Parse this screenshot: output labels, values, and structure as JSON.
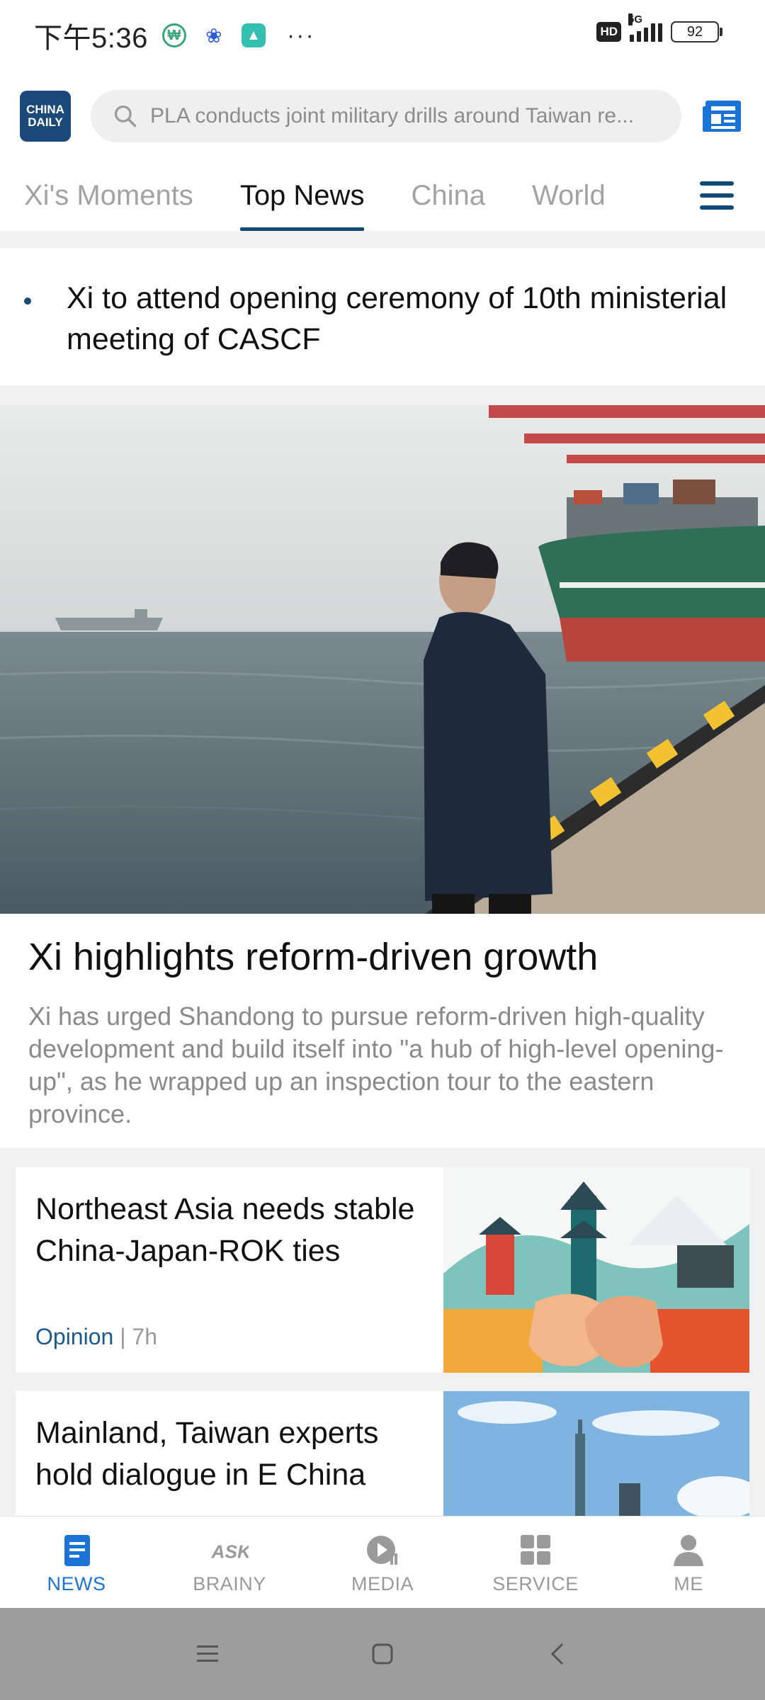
{
  "status_bar": {
    "time": "下午5:36",
    "more": "···",
    "hd": "HD",
    "network": "5G",
    "battery": "92"
  },
  "header": {
    "logo_line1": "CHINA",
    "logo_line2": "DAILY",
    "search_placeholder": "PLA conducts joint military drills around Taiwan re..."
  },
  "tabs": [
    {
      "label": "Xi's Moments",
      "active": false
    },
    {
      "label": "Top News",
      "active": true
    },
    {
      "label": "China",
      "active": false
    },
    {
      "label": "World",
      "active": false
    }
  ],
  "headline": {
    "text": "Xi to attend opening ceremony of 10th ministerial meeting of CASCF"
  },
  "hero": {
    "title": "Xi highlights reform-driven growth",
    "description": "Xi has urged Shandong to pursue reform-driven high-quality development and build itself into \"a hub of high-level opening-up\", as he wrapped up an inspection tour to the eastern province."
  },
  "cards": [
    {
      "title": "Northeast Asia needs stable China-Japan-ROK ties",
      "category": "Opinion",
      "separator": " | ",
      "time": "7h"
    },
    {
      "title": "Mainland, Taiwan experts hold dialogue in E China"
    }
  ],
  "bottom_nav": [
    {
      "label": "NEWS",
      "icon": "news-icon",
      "active": true
    },
    {
      "label": "BRAINY",
      "icon": "ask-icon",
      "active": false
    },
    {
      "label": "MEDIA",
      "icon": "play-icon",
      "active": false
    },
    {
      "label": "SERVICE",
      "icon": "grid-icon",
      "active": false
    },
    {
      "label": "ME",
      "icon": "person-icon",
      "active": false
    }
  ],
  "colors": {
    "brand_navy": "#124a78",
    "active_blue": "#1a73d6",
    "tab_inactive": "#a3a3a3",
    "system_bar": "#9d9d9d"
  }
}
